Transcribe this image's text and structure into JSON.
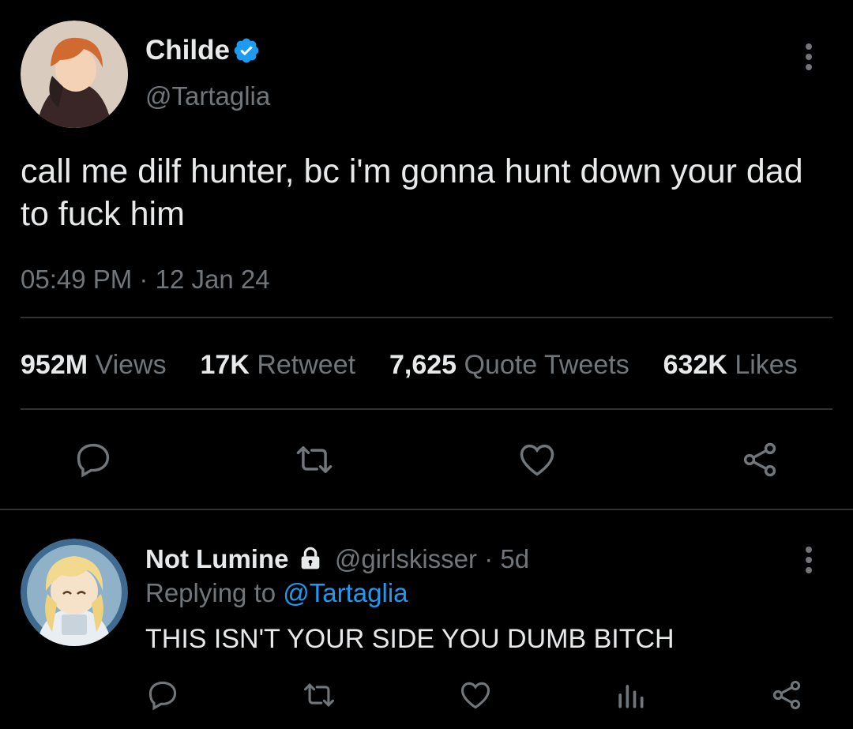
{
  "tweet": {
    "author_name": "Childe",
    "handle": "@Tartaglia",
    "verified": true,
    "text": "call me dilf hunter, bc i'm gonna hunt down your dad to fuck him",
    "time": "05:49 PM",
    "separator": "·",
    "date": "12 Jan 24",
    "stats": {
      "views_count": "952M",
      "views_label": "Views",
      "retweets_count": "17K",
      "retweets_label": "Retweet",
      "quotes_count": "7,625",
      "quotes_label": "Quote Tweets",
      "likes_count": "632K",
      "likes_label": "Likes"
    }
  },
  "reply": {
    "author_name": "Not Lumine",
    "handle": "@girlskisser",
    "age": "· 5d",
    "replying_prefix": "Replying to",
    "replying_handle": "@Tartaglia",
    "text": "THIS ISN'T YOUR SIDE YOU DUMB BITCH"
  },
  "colors": {
    "background": "#000000",
    "text": "#e7e9ea",
    "muted": "#71767b",
    "accent": "#1d9bf0",
    "divider": "#2f3336"
  },
  "icons": {
    "verified": "verified-badge-icon",
    "lock": "lock-icon",
    "more": "more-vertical-icon",
    "reply": "reply-icon",
    "retweet": "retweet-icon",
    "like": "heart-icon",
    "share": "share-icon",
    "analytics": "analytics-icon"
  }
}
